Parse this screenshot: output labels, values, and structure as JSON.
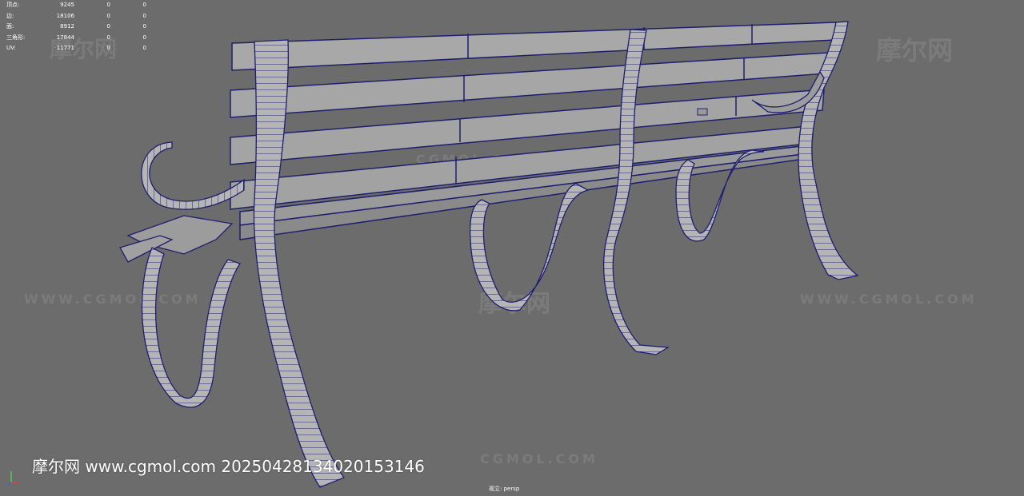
{
  "stats": {
    "rows": [
      {
        "label": "顶点:",
        "v1": "9245",
        "v2": "0",
        "v3": "0"
      },
      {
        "label": "边:",
        "v1": "18106",
        "v2": "0",
        "v3": "0"
      },
      {
        "label": "面:",
        "v1": "8912",
        "v2": "0",
        "v3": "0"
      },
      {
        "label": "三角形:",
        "v1": "17844",
        "v2": "0",
        "v3": "0"
      },
      {
        "label": "UV:",
        "v1": "11771",
        "v2": "0",
        "v3": "0"
      }
    ]
  },
  "watermark": {
    "brand_cn": "摩尔网",
    "site_upper": "WWW.CGMOL.COM",
    "site_mid": "CGMOL.COM"
  },
  "footer": {
    "text": "摩尔网 www.cgmol.com 20250428134020153146"
  },
  "camera": {
    "label": "视立: persp"
  },
  "colors": {
    "viewport_bg": "#6c6c6c",
    "wire": "#1e1e6e",
    "slat_fill": "#a9a9a9",
    "leg_fill": "#b4b4b4"
  }
}
